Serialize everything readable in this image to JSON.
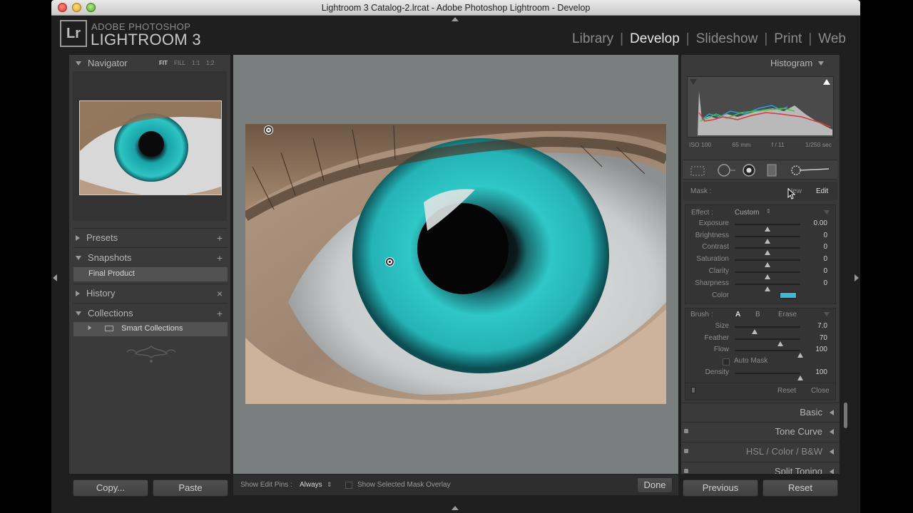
{
  "window": {
    "title": "Lightroom 3 Catalog-2.lrcat - Adobe Photoshop Lightroom - Develop"
  },
  "identity": {
    "badge": "Lr",
    "line1": "ADOBE PHOTOSHOP",
    "line2": "LIGHTROOM 3"
  },
  "modules": [
    "Library",
    "Develop",
    "Slideshow",
    "Print",
    "Web"
  ],
  "active_module": "Develop",
  "left_panel": {
    "navigator": {
      "title": "Navigator",
      "zoom_options": [
        "FIT",
        "FILL",
        "1:1",
        "1:2"
      ]
    },
    "presets": {
      "title": "Presets",
      "action": "+"
    },
    "snapshots": {
      "title": "Snapshots",
      "action": "+",
      "items": [
        "Final Product"
      ]
    },
    "history": {
      "title": "History",
      "action": "×"
    },
    "collections": {
      "title": "Collections",
      "action": "+",
      "items": [
        "Smart Collections"
      ]
    },
    "copy_label": "Copy...",
    "paste_label": "Paste"
  },
  "toolbar": {
    "show_pins_label": "Show Edit Pins :",
    "show_pins_value": "Always",
    "overlay_label": "Show Selected Mask Overlay",
    "done_label": "Done"
  },
  "right_panel": {
    "histogram": {
      "title": "Histogram",
      "iso": "ISO 100",
      "focal": "65 mm",
      "aperture": "f / 11",
      "shutter": "1/250 sec"
    },
    "mask": {
      "label": "Mask :",
      "new": "New",
      "edit": "Edit"
    },
    "effect": {
      "label": "Effect :",
      "preset": "Custom",
      "sliders": [
        {
          "name": "Exposure",
          "value": "0.00",
          "pos": 0.5
        },
        {
          "name": "Brightness",
          "value": "0",
          "pos": 0.5
        },
        {
          "name": "Contrast",
          "value": "0",
          "pos": 0.5
        },
        {
          "name": "Saturation",
          "value": "0",
          "pos": 0.5
        },
        {
          "name": "Clarity",
          "value": "0",
          "pos": 0.5
        },
        {
          "name": "Sharpness",
          "value": "0",
          "pos": 0.5
        }
      ],
      "color_label": "Color",
      "color_swatch": "#3cb9d4"
    },
    "brush": {
      "label": "Brush :",
      "options": [
        "A",
        "B",
        "Erase"
      ],
      "sliders": [
        {
          "name": "Size",
          "value": "7.0",
          "pos": 0.3
        },
        {
          "name": "Feather",
          "value": "70",
          "pos": 0.7
        },
        {
          "name": "Flow",
          "value": "100",
          "pos": 1.0
        }
      ],
      "auto_mask_label": "Auto Mask",
      "density": {
        "name": "Density",
        "value": "100",
        "pos": 1.0
      },
      "reset": "Reset",
      "close": "Close"
    },
    "sections": [
      "Basic",
      "Tone Curve",
      "HSL / Color / B&W",
      "Split Toning"
    ],
    "previous_label": "Previous",
    "reset_label": "Reset"
  }
}
